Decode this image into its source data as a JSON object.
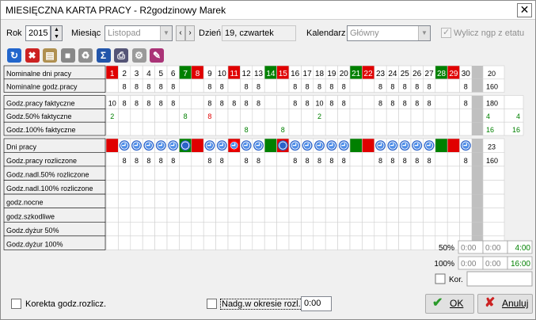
{
  "window": {
    "title": "MIESIĘCZNA KARTA PRACY - R2godzinowy Marek"
  },
  "top": {
    "rok_label": "Rok",
    "rok_value": "2015",
    "miesiac_label": "Miesiąc",
    "miesiac_value": "Listopad",
    "dzien_label": "Dzień",
    "dzien_value": "19, czwartek",
    "kalendarz_label": "Kalendarz",
    "kalendarz_value": "Główny",
    "wylicz_label": "Wylicz ngp z etatu",
    "wylicz_checked": true
  },
  "toolbar": [
    {
      "name": "refresh-icon",
      "color": "#2266cc"
    },
    {
      "name": "delete-icon",
      "color": "#cc2222"
    },
    {
      "name": "copy-icon",
      "color": "#b09050"
    },
    {
      "name": "paste-icon",
      "color": "#888888"
    },
    {
      "name": "cycle-icon",
      "color": "#909090"
    },
    {
      "name": "sum-icon",
      "color": "#2255aa"
    },
    {
      "name": "print-icon",
      "color": "#555577"
    },
    {
      "name": "settings-icon",
      "color": "#9a9a9a"
    },
    {
      "name": "edit-icon",
      "color": "#aa3377"
    }
  ],
  "days": {
    "numbers": [
      "1",
      "2",
      "3",
      "4",
      "5",
      "6",
      "7",
      "8",
      "9",
      "10",
      "11",
      "12",
      "13",
      "14",
      "15",
      "16",
      "17",
      "18",
      "19",
      "20",
      "21",
      "22",
      "23",
      "24",
      "25",
      "26",
      "27",
      "28",
      "29",
      "30"
    ],
    "types": [
      "r",
      "w",
      "w",
      "w",
      "w",
      "w",
      "g",
      "r",
      "w",
      "w",
      "r",
      "w",
      "w",
      "g",
      "r",
      "w",
      "w",
      "w",
      "w",
      "w",
      "g",
      "r",
      "w",
      "w",
      "w",
      "w",
      "w",
      "g",
      "r",
      "w"
    ],
    "selected_day": 11,
    "colors": {
      "red": "#e00000",
      "green": "#008000",
      "selected": "#ff0000"
    }
  },
  "rows_a": [
    {
      "label": "Nominalne dni pracy",
      "kind": "header",
      "total": "20"
    },
    {
      "label": "Nominalne godz.pracy",
      "cells": [
        "",
        "8",
        "8",
        "8",
        "8",
        "8",
        "",
        "",
        "8",
        "8",
        "",
        "8",
        "8",
        "",
        "",
        "8",
        "8",
        "8",
        "8",
        "8",
        "",
        "",
        "8",
        "8",
        "8",
        "8",
        "8",
        "",
        "",
        "8"
      ],
      "total": "160"
    }
  ],
  "rows_b": [
    {
      "label": "Godz.pracy faktyczne",
      "cells": [
        "10",
        "8",
        "8",
        "8",
        "8",
        "8",
        "",
        "",
        "8",
        "8",
        "8",
        "8",
        "8",
        "",
        "",
        "8",
        "8",
        "10",
        "8",
        "8",
        "",
        "",
        "8",
        "8",
        "8",
        "8",
        "8",
        "",
        "",
        "8"
      ],
      "total": "180",
      "extra": ""
    },
    {
      "label": "Godz.50% faktyczne",
      "cells": [
        "2",
        "",
        "",
        "",
        "",
        "",
        "8",
        "",
        "8",
        "",
        "",
        "",
        "",
        "",
        "",
        "",
        "",
        "2",
        "",
        "",
        "",
        "",
        "",
        "",
        "",
        "",
        "",
        "",
        "",
        ""
      ],
      "colors": [
        "green",
        "",
        "",
        "",
        "",
        "",
        "green",
        "",
        "red",
        "",
        "",
        "",
        "",
        "",
        "",
        "",
        "",
        "green",
        "",
        "",
        "",
        "",
        "",
        "",
        "",
        "",
        "",
        "",
        "",
        ""
      ],
      "total": "4",
      "extra": "4"
    },
    {
      "label": "Godz.100% faktyczne",
      "cells": [
        "",
        "",
        "",
        "",
        "",
        "",
        "",
        "",
        "",
        "",
        "",
        "8",
        "",
        "",
        "8",
        "",
        "",
        "",
        "",
        "",
        "",
        "",
        "",
        "",
        "",
        "",
        "",
        "",
        "",
        ""
      ],
      "colors": [
        "",
        "",
        "",
        "",
        "",
        "",
        "",
        "",
        "",
        "",
        "",
        "green",
        "",
        "",
        "green",
        "",
        "",
        "",
        "",
        "",
        "",
        "",
        "",
        "",
        "",
        "",
        "",
        "",
        "",
        ""
      ],
      "total": "16",
      "extra": "16"
    }
  ],
  "rows_c": [
    {
      "label": "Dni pracy",
      "kind": "icons",
      "total": "23"
    },
    {
      "label": "Godz.pracy rozliczone",
      "cells": [
        "",
        "8",
        "8",
        "8",
        "8",
        "8",
        "",
        "",
        "8",
        "8",
        "",
        "8",
        "8",
        "",
        "",
        "8",
        "8",
        "8",
        "8",
        "8",
        "",
        "",
        "8",
        "8",
        "8",
        "8",
        "8",
        "",
        "",
        "8"
      ],
      "total": "160"
    },
    {
      "label": "Godz.nadl.50% rozliczone",
      "cells": [],
      "total": ""
    },
    {
      "label": "Godz.nadl.100% rozliczone",
      "cells": [],
      "total": ""
    },
    {
      "label": "godz.nocne",
      "cells": [],
      "total": ""
    },
    {
      "label": "godz.szkodliwe",
      "cells": [],
      "total": ""
    },
    {
      "label": "Godz.dyżur 50%",
      "cells": [],
      "total": ""
    },
    {
      "label": "Godz.dyżur 100%",
      "cells": [],
      "total": ""
    }
  ],
  "summary": {
    "row50_label": "50%",
    "row50": [
      "0:00",
      "0:00",
      "4:00"
    ],
    "row100_label": "100%",
    "row100": [
      "0:00",
      "0:00",
      "16:00"
    ],
    "kor_label": "Kor.",
    "kor_value": ""
  },
  "bottom": {
    "korekta_label": "Korekta godz.rozlicz.",
    "nadg_label": "Nadg.w okresie rozl.",
    "nadg_value": "0:00",
    "ok_label": "OK",
    "anuluj_label": "Anuluj"
  }
}
